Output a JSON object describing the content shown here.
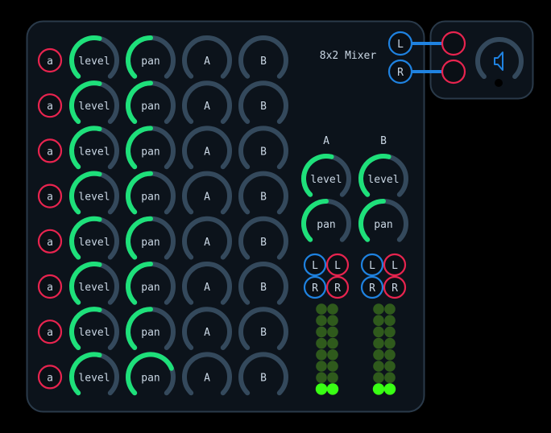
{
  "mixer": {
    "title": "8x2 Mixer",
    "colors": {
      "panel_bg": "#0c131b",
      "panel_border": "#2a3a4a",
      "active_green": "#1ee07a",
      "track_gray": "#34495c",
      "pink": "#e8244f",
      "blue": "#1f82e0",
      "text": "#c9d6e3",
      "led_off": "#2f5a1c",
      "led_on": "#39ff14"
    },
    "channels": [
      {
        "input_label": "a",
        "level": {
          "label": "level",
          "value": 0.55
        },
        "pan": {
          "label": "pan",
          "value": 0.5
        },
        "send_a": {
          "label": "A",
          "value": 0.0
        },
        "send_b": {
          "label": "B",
          "value": 0.0
        }
      },
      {
        "input_label": "a",
        "level": {
          "label": "level",
          "value": 0.55
        },
        "pan": {
          "label": "pan",
          "value": 0.5
        },
        "send_a": {
          "label": "A",
          "value": 0.0
        },
        "send_b": {
          "label": "B",
          "value": 0.0
        }
      },
      {
        "input_label": "a",
        "level": {
          "label": "level",
          "value": 0.55
        },
        "pan": {
          "label": "pan",
          "value": 0.5
        },
        "send_a": {
          "label": "A",
          "value": 0.0
        },
        "send_b": {
          "label": "B",
          "value": 0.0
        }
      },
      {
        "input_label": "a",
        "level": {
          "label": "level",
          "value": 0.55
        },
        "pan": {
          "label": "pan",
          "value": 0.5
        },
        "send_a": {
          "label": "A",
          "value": 0.0
        },
        "send_b": {
          "label": "B",
          "value": 0.0
        }
      },
      {
        "input_label": "a",
        "level": {
          "label": "level",
          "value": 0.55
        },
        "pan": {
          "label": "pan",
          "value": 0.5
        },
        "send_a": {
          "label": "A",
          "value": 0.0
        },
        "send_b": {
          "label": "B",
          "value": 0.0
        }
      },
      {
        "input_label": "a",
        "level": {
          "label": "level",
          "value": 0.55
        },
        "pan": {
          "label": "pan",
          "value": 0.5
        },
        "send_a": {
          "label": "A",
          "value": 0.0
        },
        "send_b": {
          "label": "B",
          "value": 0.0
        }
      },
      {
        "input_label": "a",
        "level": {
          "label": "level",
          "value": 0.55
        },
        "pan": {
          "label": "pan",
          "value": 0.5
        },
        "send_a": {
          "label": "A",
          "value": 0.0
        },
        "send_b": {
          "label": "B",
          "value": 0.0
        }
      },
      {
        "input_label": "a",
        "level": {
          "label": "level",
          "value": 0.55
        },
        "pan": {
          "label": "pan",
          "value": 0.75
        },
        "send_a": {
          "label": "A",
          "value": 0.0
        },
        "send_b": {
          "label": "B",
          "value": 0.0
        }
      }
    ],
    "buses": [
      {
        "header": "A",
        "level": {
          "label": "level",
          "value": 0.55
        },
        "pan": {
          "label": "pan",
          "value": 0.5
        },
        "outputs": [
          "L",
          "L",
          "R",
          "R"
        ],
        "meter": {
          "lit_rows": 1,
          "rows": 8
        }
      },
      {
        "header": "B",
        "level": {
          "label": "level",
          "value": 0.55
        },
        "pan": {
          "label": "pan",
          "value": 0.5
        },
        "outputs": [
          "L",
          "L",
          "R",
          "R"
        ],
        "meter": {
          "lit_rows": 1,
          "rows": 8
        }
      }
    ],
    "main_out": {
      "left_label": "L",
      "right_label": "R"
    }
  },
  "speaker": {
    "icon": "speaker-icon",
    "volume": {
      "value": 0.45
    }
  }
}
